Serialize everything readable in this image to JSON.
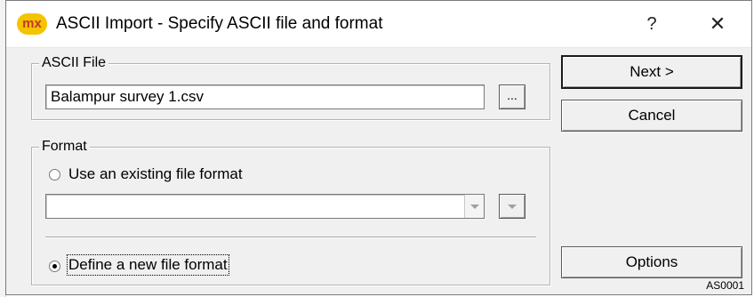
{
  "window": {
    "icon_text": "mx",
    "title": "ASCII Import - Specify ASCII file and format",
    "help_label": "?",
    "close_label": "✕"
  },
  "ascii_file": {
    "group_label": "ASCII File",
    "file_value": "Balampur survey 1.csv",
    "browse_label": "..."
  },
  "format": {
    "group_label": "Format",
    "existing_label": "Use an existing file format",
    "existing_selected": false,
    "format_value": "",
    "define_label": "Define a new file format",
    "define_selected": true
  },
  "buttons": {
    "next_label": "Next >",
    "cancel_label": "Cancel",
    "options_label": "Options"
  },
  "status": {
    "code": "AS0001"
  }
}
